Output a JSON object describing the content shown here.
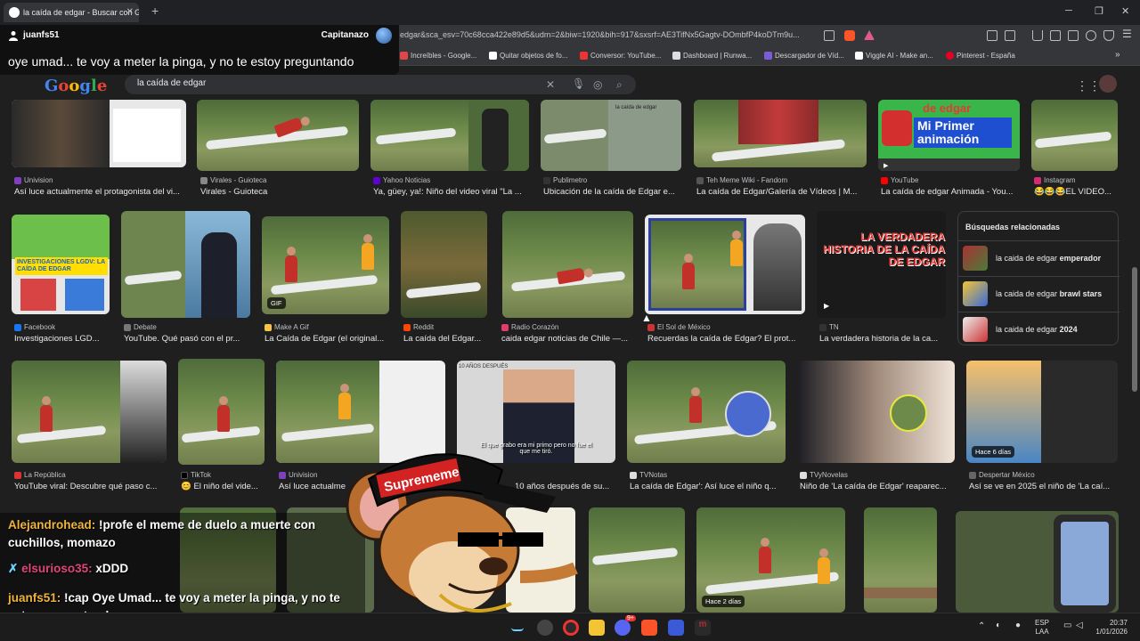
{
  "browser": {
    "tab_title": "la caída de edgar - Buscar con G",
    "url": "edgar&sca_esv=70c68cca422e89d5&udm=2&biw=1920&bih=917&sxsrf=AE3TifNx5Gagtv-DOmbfP4koDTm9u...",
    "bookmarks": [
      "Increíbles - Google...",
      "Quitar objetos de fo...",
      "Conversor: YouTube...",
      "Dashboard | Runwa...",
      "Descargador de Víd...",
      "Viggle AI - Make an...",
      "Pinterest - España"
    ]
  },
  "overlay_top": {
    "user": "juanfs51",
    "channel": "Capitanazo",
    "message": "oye umad... te voy a meter la pinga, y no te estoy preguntando"
  },
  "search": {
    "logo": "Google",
    "query": "la caída de edgar"
  },
  "results_row1": [
    {
      "source": "Univision",
      "caption": "Así luce actualmente el protagonista del vi..."
    },
    {
      "source": "Virales - Guioteca",
      "caption": "Virales - Guioteca"
    },
    {
      "source": "Yahoo Noticias",
      "caption": "Ya, güey, ya!: Niño del video viral \"La ..."
    },
    {
      "source": "Publimetro",
      "caption": "Ubicación de la caída de Edgar e..."
    },
    {
      "source": "Teh Meme Wiki - Fandom",
      "caption": "La caída de Edgar/Galería de Vídeos | M..."
    },
    {
      "source": "YouTube",
      "caption": "La caída de edgar Animada - You..."
    },
    {
      "source": "Instagram",
      "caption": "😂😂😂EL VIDEO..."
    }
  ],
  "row1_thumb_texts": {
    "map_label": "la caída de edgar",
    "animation_title": "Mi Primer animación",
    "animation_top": "de edgar"
  },
  "results_row2": [
    {
      "source": "Facebook",
      "caption": "Investigaciones LGD..."
    },
    {
      "source": "Debate",
      "caption": "YouTube. Qué pasó con el pr..."
    },
    {
      "source": "Make A Gif",
      "caption": "La Caída de Edgar (el original..."
    },
    {
      "source": "Reddit",
      "caption": "La caída del Edgar..."
    },
    {
      "source": "Radio Corazón",
      "caption": "caida edgar noticias de Chile —..."
    },
    {
      "source": "El Sol de México",
      "caption": "Recuerdas la caída de Edgar? El prot..."
    },
    {
      "source": "TN",
      "caption": "La verdadera historia de la ca..."
    }
  ],
  "row2_thumb_texts": {
    "investigaciones": "INVESTIGACIONES LGDV: LA CAÍDA DE EDGAR",
    "gif_badge": "GIF",
    "verdadera": "LA VERDADERA HISTORIA DE LA CAÍDA DE EDGAR"
  },
  "related": {
    "title": "Búsquedas relacionadas",
    "items": [
      {
        "prefix": "la caida de edgar ",
        "bold": "emperador"
      },
      {
        "prefix": "la caida de edgar ",
        "bold": "brawl stars"
      },
      {
        "prefix": "la caida de edgar ",
        "bold": "2024"
      }
    ]
  },
  "results_row3": [
    {
      "source": "La República",
      "caption": "YouTube viral: Descubre qué paso c..."
    },
    {
      "source": "TikTok",
      "caption": "😊 El niño del vide..."
    },
    {
      "source": "Univision",
      "caption": "Así luce actualme"
    },
    {
      "source": "",
      "caption": "10 años después de su..."
    },
    {
      "source": "TVNotas",
      "caption": "La caída de Edgar': Así luce el niño q..."
    },
    {
      "source": "TVyNovelas",
      "caption": "Niño de 'La caída de Edgar' reaparec..."
    },
    {
      "source": "Despertar México",
      "caption": "Así se ve en 2025 el niño de 'La caí..."
    }
  ],
  "row3_thumb_texts": {
    "anos": "10 AÑOS DESPUÉS",
    "subtitle": "El que grabo era mi primo pero no fue el que me tiró.",
    "hace": "Hace 6 días"
  },
  "row4_thumb_texts": {
    "hace": "Hace 2 días"
  },
  "chat": [
    {
      "user": "Alejandrohead:",
      "text": " !profe el meme de duelo a muerte con cuchillos, momazo",
      "color": "#f0b43c"
    },
    {
      "user": "elsurioso35:",
      "text": " xDDD",
      "color": "#e0457b"
    },
    {
      "user": "juanfs51:",
      "text": " !cap Oye Umad... te voy a meter la pinga, y no te estoy preguntando",
      "color": "#f0b43c"
    }
  ],
  "cartoon": {
    "cap_text": "Suprememe"
  },
  "taskbar": {
    "lang": "ESP",
    "lang2": "LAA",
    "time": "20:37",
    "date": "1/01/2026",
    "badge": "9+"
  }
}
